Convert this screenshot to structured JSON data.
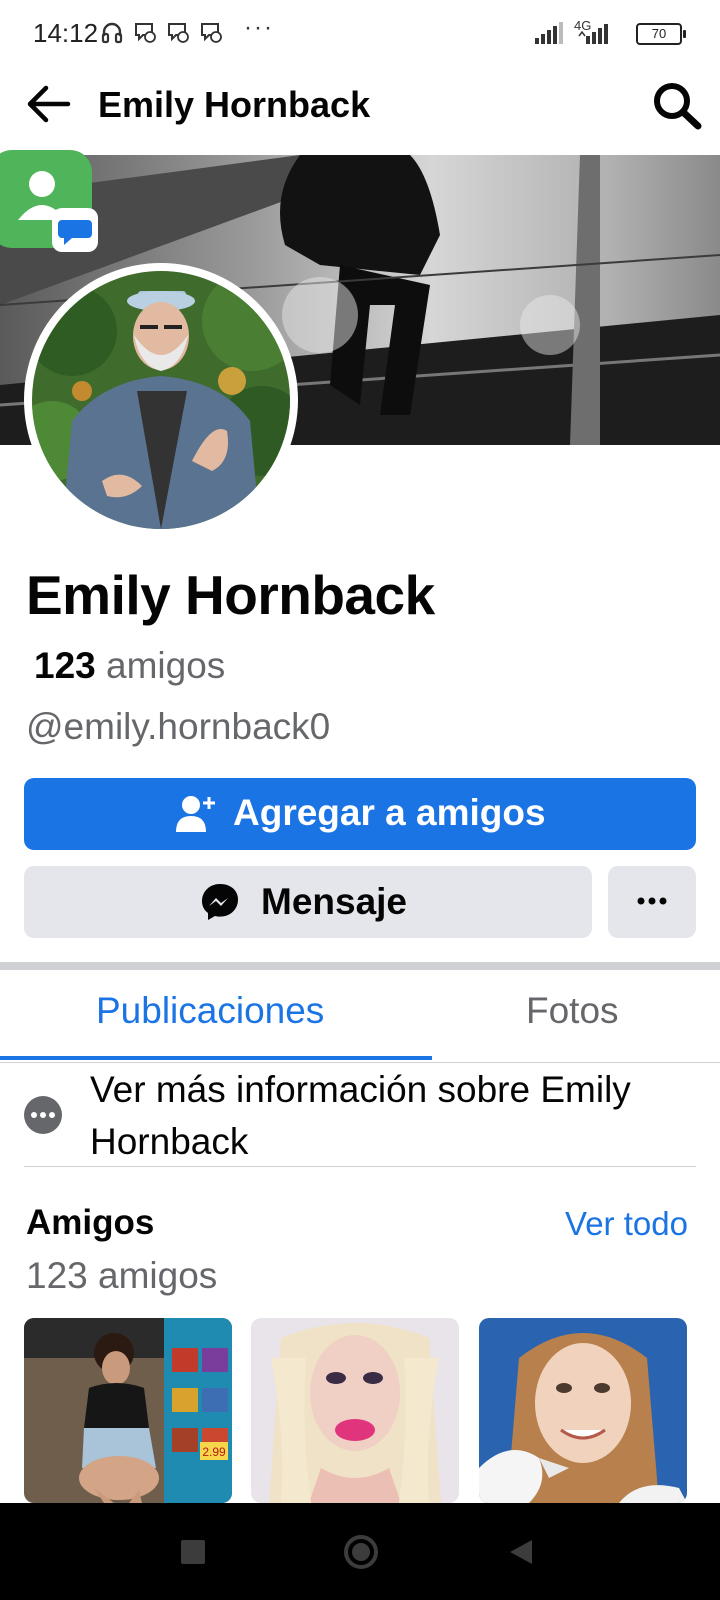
{
  "status_bar": {
    "time": "14:12",
    "network": "4G",
    "battery": "70"
  },
  "header": {
    "title": "Emily Hornback"
  },
  "profile": {
    "name": "Emily Hornback",
    "friend_count": "123",
    "friend_word": "amigos",
    "handle": "@emily.hornback0"
  },
  "actions": {
    "add_friend_label": "Agregar a amigos",
    "message_label": "Mensaje",
    "more_label": "···"
  },
  "tabs": [
    {
      "label": "Publicaciones",
      "active": true
    },
    {
      "label": "Fotos",
      "active": false
    }
  ],
  "info_link": "Ver más información sobre Emily Hornback",
  "friends_section": {
    "title": "Amigos",
    "see_all": "Ver todo",
    "count_text": "123 amigos",
    "photo_price_tag": "2.99"
  },
  "colors": {
    "accent": "#1b74e4",
    "secondary_button": "#e4e6eb",
    "muted_text": "#65676b"
  },
  "icons": [
    "back-arrow-icon",
    "search-icon",
    "add-friend-icon",
    "messenger-icon",
    "more-dots-icon",
    "nav-recents-icon",
    "nav-home-icon",
    "nav-back-icon"
  ]
}
